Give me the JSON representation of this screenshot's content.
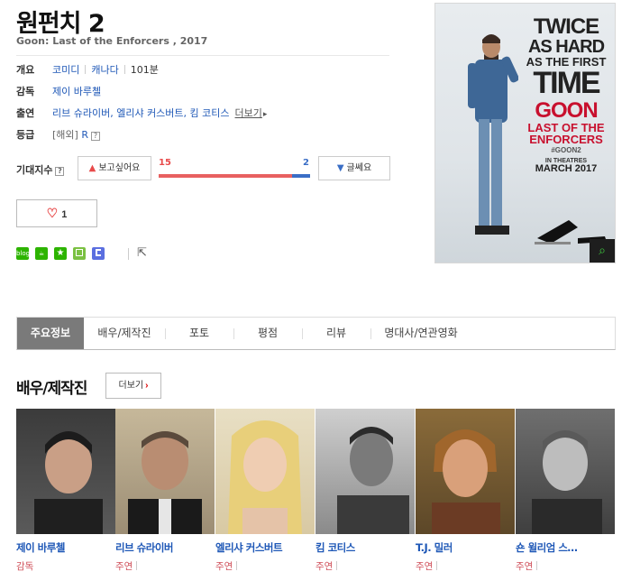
{
  "movie": {
    "title": "원펀치 2",
    "subtitle": "Goon: Last of the Enforcers , 2017"
  },
  "info": {
    "overview_label": "개요",
    "genre": "코미디",
    "country": "캐나다",
    "runtime": "101분",
    "director_label": "감독",
    "director": "제이 바루첼",
    "cast_label": "출연",
    "cast_list": "리브 슈라이버, 엘리샤 커스버트, 킴 코티스",
    "more_label": "더보기",
    "rating_label": "등급",
    "rating_region": "[해외]",
    "rating_value": "R",
    "help_glyph": "?"
  },
  "expect": {
    "label": "기대지수",
    "want_label": "보고싶어요",
    "meh_label": "글쎄요",
    "want_count": "15",
    "meh_count": "2",
    "want_fraction": 0.882
  },
  "like": {
    "count": "1"
  },
  "share": {
    "icons": [
      "blog-icon",
      "cafe-icon",
      "bookmark-icon",
      "memo-icon",
      "keep-icon"
    ],
    "blog_text": "blog"
  },
  "poster": {
    "line1": "TWICE",
    "line2": "AS HARD",
    "line3": "AS THE FIRST",
    "line4": "TIME",
    "goon": "GOON",
    "sub1": "LAST OF THE",
    "sub2": "ENFORCERS",
    "tag": "#GOON2",
    "in_theatres": "IN THEATRES",
    "date": "MARCH 2017"
  },
  "tabs": [
    "주요정보",
    "배우/제작진",
    "포토",
    "평점",
    "리뷰",
    "명대사/연관영화"
  ],
  "cast_section": {
    "title": "배우/제작진",
    "more_label": "더보기",
    "people": [
      {
        "name": "제이 바루첼",
        "role": "감독"
      },
      {
        "name": "리브 슈라이버",
        "role": "주연"
      },
      {
        "name": "엘리샤 커스버트",
        "role": "주연"
      },
      {
        "name": "킴 코티스",
        "role": "주연"
      },
      {
        "name": "T.J. 밀러",
        "role": "주연"
      },
      {
        "name": "숀 윌리엄 스…",
        "role": "주연"
      }
    ]
  },
  "colors": {
    "link": "#1f58b7",
    "red": "#e84a4a",
    "blue": "#3a6ec6",
    "tab_active": "#7a7a7a"
  }
}
